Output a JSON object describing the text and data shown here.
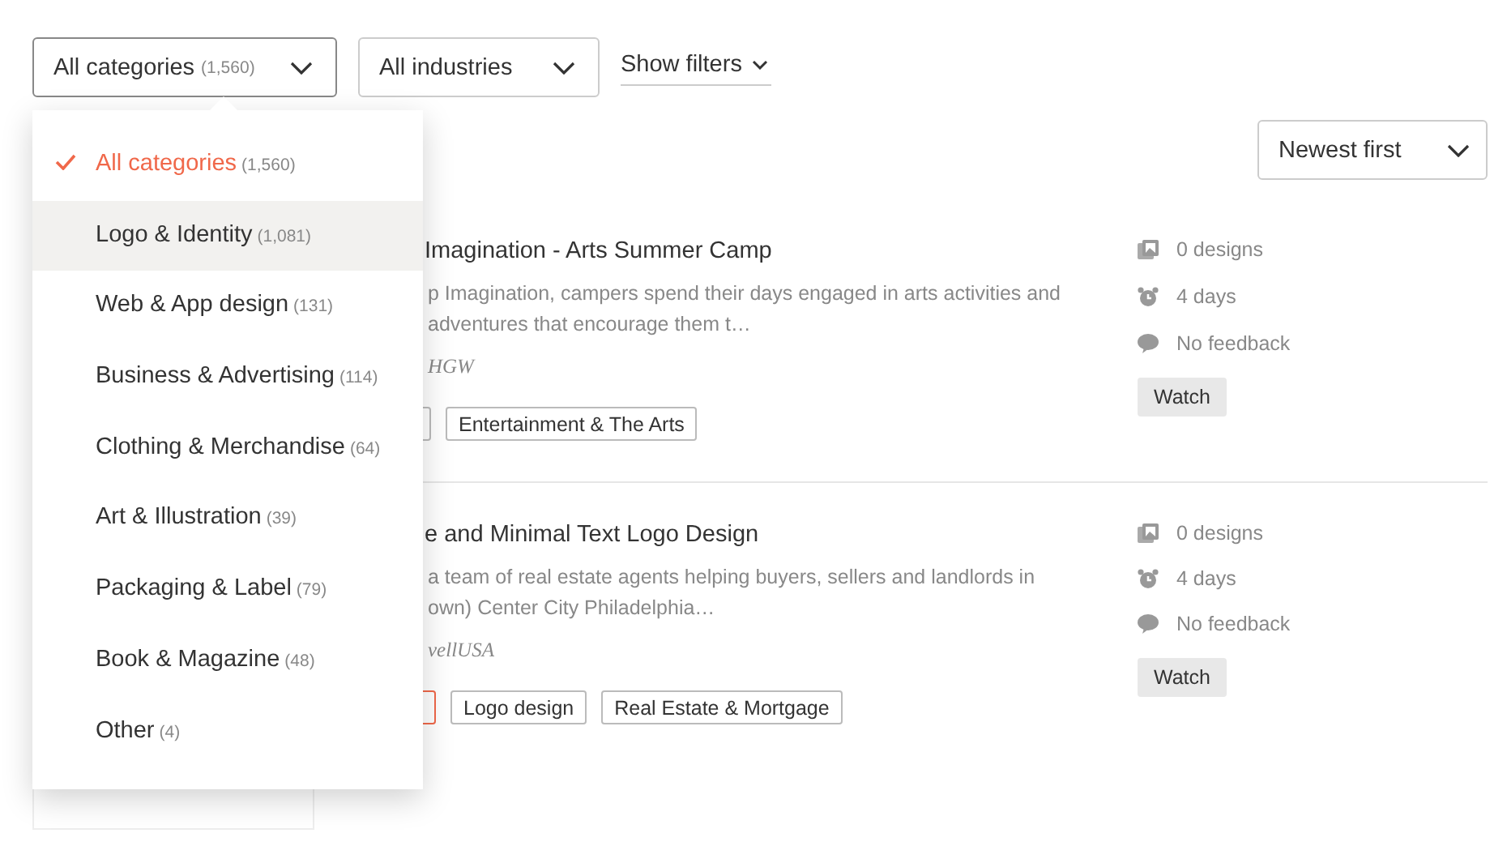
{
  "category_select": {
    "value": "All categories",
    "count": "(1,560)",
    "expanded": true
  },
  "industry_select": {
    "value": "All industries"
  },
  "filters_toggle": {
    "label": "Show filters"
  },
  "category_menu": {
    "items": [
      {
        "label": "All categories",
        "count": "(1,560)",
        "selected": true,
        "highlighted": false
      },
      {
        "label": "Logo & Identity",
        "count": "(1,081)",
        "selected": false,
        "highlighted": true
      },
      {
        "label": "Web & App design",
        "count": "(131)",
        "selected": false,
        "highlighted": false
      },
      {
        "label": "Business & Advertising",
        "count": "(114)",
        "selected": false,
        "highlighted": false
      },
      {
        "label": "Clothing & Merchandise",
        "count": "(64)",
        "selected": false,
        "highlighted": false
      },
      {
        "label": "Art & Illustration",
        "count": "(39)",
        "selected": false,
        "highlighted": false
      },
      {
        "label": "Packaging & Label",
        "count": "(79)",
        "selected": false,
        "highlighted": false
      },
      {
        "label": "Book & Magazine",
        "count": "(48)",
        "selected": false,
        "highlighted": false
      },
      {
        "label": "Other",
        "count": "(4)",
        "selected": false,
        "highlighted": false
      }
    ]
  },
  "sort_select": {
    "value": "Newest first"
  },
  "listings": [
    {
      "title": "Imagination - Arts Summer Camp",
      "description": [
        "p Imagination, campers spend their days engaged in arts activities and",
        "adventures that encourage them t…"
      ],
      "author": "HGW",
      "tags": [
        {
          "kind": "cut"
        },
        {
          "kind": "plain",
          "label": "Entertainment & The Arts"
        }
      ],
      "designs": "0 designs",
      "time_left": "4 days",
      "feedback": "No feedback",
      "watch": "Watch"
    },
    {
      "title": "e and Minimal Text Logo Design",
      "description": [
        "a team of real estate agents helping buyers, sellers and landlords in",
        "own) Center City Philadelphia…"
      ],
      "author": "vellUSA",
      "tags": [
        {
          "kind": "cut-featured"
        },
        {
          "kind": "plain",
          "label": "Logo design"
        },
        {
          "kind": "plain",
          "label": "Real Estate & Mortgage"
        }
      ],
      "designs": "0 designs",
      "time_left": "4 days",
      "feedback": "No feedback",
      "watch": "Watch"
    }
  ]
}
